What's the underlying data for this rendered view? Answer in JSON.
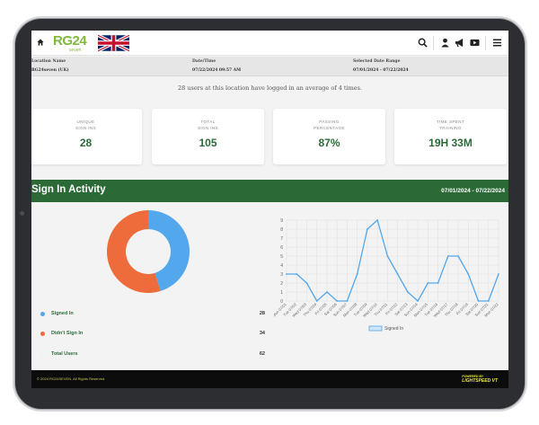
{
  "header": {
    "logo_text": "RG24",
    "logo_sub": "seven"
  },
  "info": {
    "location_label": "Location Name",
    "location_value": "RG24seven (UK)",
    "datetime_label": "Date/Time",
    "datetime_value": "07/22/2024 09:57 AM",
    "range_label": "Selected Date Range",
    "range_value": "07/01/2024 - 07/22/2024"
  },
  "summary": "28 users at this location have logged in an average of 4 times.",
  "stats": [
    {
      "label": "UNIQUE\nSIGN INS",
      "value": "28"
    },
    {
      "label": "TOTAL\nSIGN INS",
      "value": "105"
    },
    {
      "label": "PASSING\nPERCENTAGE",
      "value": "87%"
    },
    {
      "label": "TIME SPENT\nTRAINING",
      "value": "19H 33M"
    }
  ],
  "activity": {
    "title": "Sign In Activity",
    "range": "07/01/2024 - 07/22/2024"
  },
  "legend": [
    {
      "name": "Signed In",
      "count": "28",
      "color": "#53a7ec"
    },
    {
      "name": "Didn't Sign In",
      "count": "34",
      "color": "#ee6b3b"
    },
    {
      "name": "Total Users",
      "count": "62",
      "color": "#f1f1f1"
    }
  ],
  "chart_data": [
    {
      "type": "pie",
      "title": "",
      "categories": [
        "Signed In",
        "Didn't Sign In"
      ],
      "values": [
        28,
        34
      ],
      "colors": [
        "#53a7ec",
        "#ee6b3b"
      ]
    },
    {
      "type": "line",
      "title": "",
      "categories": [
        "Mon 07/01",
        "Tue 07/02",
        "Wed 07/03",
        "Thu 07/04",
        "Fri 07/05",
        "Sat 07/06",
        "Sun 07/07",
        "Mon 07/08",
        "Tue 07/09",
        "Wed 07/10",
        "Thu 07/11",
        "Fri 07/12",
        "Sat 07/13",
        "Sun 07/14",
        "Mon 07/15",
        "Tue 07/16",
        "Wed 07/17",
        "Thu 07/18",
        "Fri 07/19",
        "Sat 07/20",
        "Sun 07/21",
        "Mon 07/22"
      ],
      "series": [
        {
          "name": "Signed In",
          "values": [
            3,
            3,
            2,
            0,
            1,
            0,
            0,
            3,
            8,
            9,
            5,
            3,
            1,
            0,
            2,
            2,
            5,
            5,
            3,
            0,
            0,
            3
          ],
          "color": "#53a7ec"
        }
      ],
      "ylim": [
        0,
        9
      ],
      "yticks": [
        0,
        1,
        2,
        3,
        4,
        5,
        6,
        7,
        8,
        9
      ],
      "grid": true,
      "legend_position": "bottom"
    }
  ],
  "footer": {
    "copyright": "© 2024 RG24SEVEN. All Rights Reserved.",
    "powered_by": "POWERED BY",
    "brand": "LIGHTSPEED VT"
  }
}
